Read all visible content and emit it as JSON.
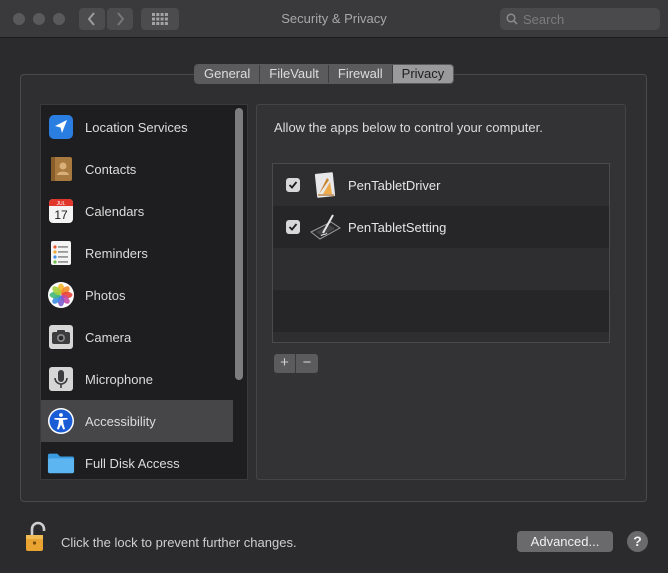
{
  "window": {
    "title": "Security & Privacy",
    "back_label": "‹",
    "forward_label": "›"
  },
  "search": {
    "placeholder": "Search"
  },
  "tabs": [
    {
      "label": "General"
    },
    {
      "label": "FileVault"
    },
    {
      "label": "Firewall"
    },
    {
      "label": "Privacy",
      "active": true
    }
  ],
  "sidebar": {
    "items": [
      {
        "label": "Location Services",
        "icon": "location-arrow-icon"
      },
      {
        "label": "Contacts",
        "icon": "contacts-book-icon"
      },
      {
        "label": "Calendars",
        "icon": "calendar-icon",
        "calendar_month": "JUL",
        "calendar_day": "17"
      },
      {
        "label": "Reminders",
        "icon": "reminders-list-icon"
      },
      {
        "label": "Photos",
        "icon": "photos-flower-icon"
      },
      {
        "label": "Camera",
        "icon": "camera-icon"
      },
      {
        "label": "Microphone",
        "icon": "microphone-icon"
      },
      {
        "label": "Accessibility",
        "icon": "accessibility-icon",
        "selected": true
      },
      {
        "label": "Full Disk Access",
        "icon": "folder-icon"
      }
    ]
  },
  "content": {
    "description": "Allow the apps below to control your computer.",
    "apps": [
      {
        "name": "PenTabletDriver",
        "checked": true,
        "icon": "pen-tablet-driver-icon"
      },
      {
        "name": "PenTabletSetting",
        "checked": true,
        "icon": "pen-tablet-setting-icon"
      }
    ],
    "add_label": "+",
    "remove_label": "−"
  },
  "footer": {
    "lock_text": "Click the lock to prevent further changes.",
    "advanced_label": "Advanced...",
    "help_label": "?"
  },
  "colors": {
    "selected_row": "#464648",
    "accessibility_blue": "#1a5bd6",
    "lock_orange": "#e8a330"
  }
}
